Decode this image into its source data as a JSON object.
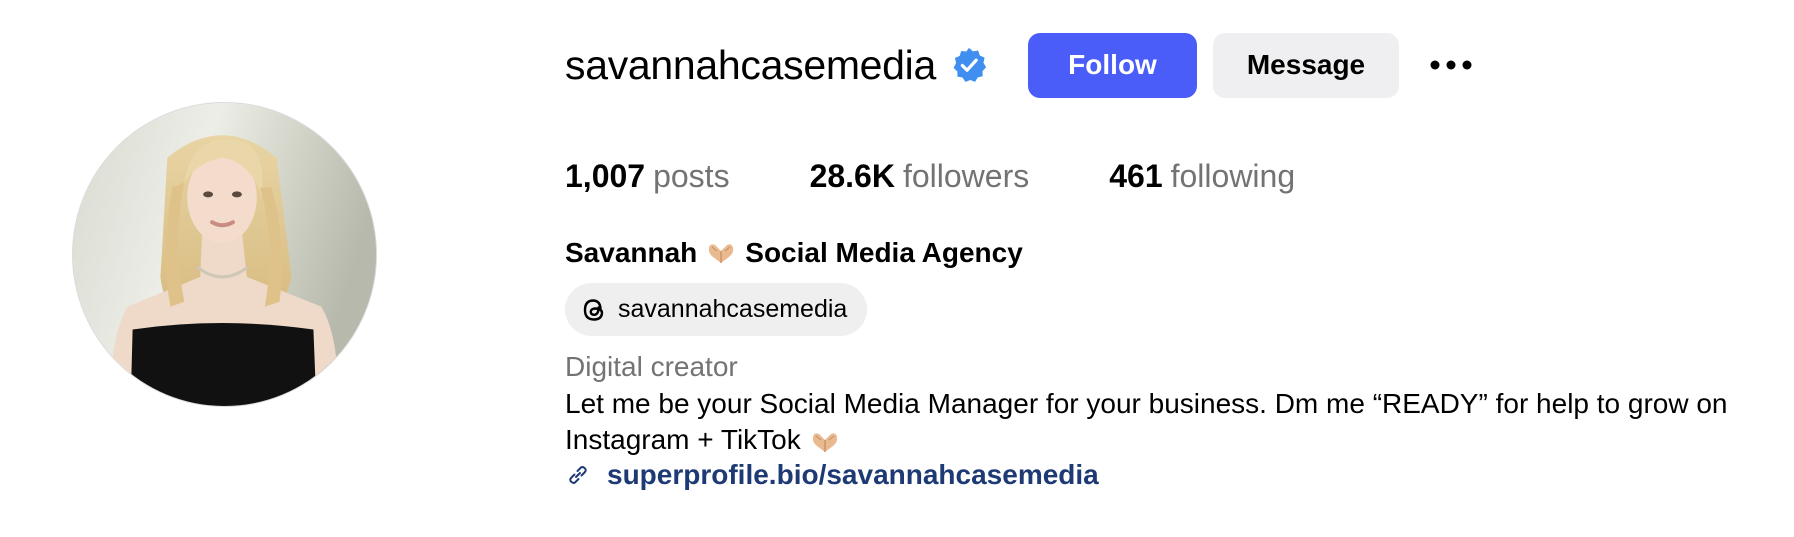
{
  "profile": {
    "username": "savannahcasemedia",
    "verified_icon": "verified-badge-icon",
    "follow_label": "Follow",
    "message_label": "Message",
    "more_icon": "more-options-icon"
  },
  "stats": {
    "posts_count": "1,007",
    "posts_label": "posts",
    "followers_count": "28.6K",
    "followers_label": "followers",
    "following_count": "461",
    "following_label": "following"
  },
  "bio": {
    "name_first": "Savannah",
    "name_rest": "Social Media Agency",
    "threads_handle": "savannahcasemedia",
    "threads_icon": "threads-icon",
    "category": "Digital creator",
    "line1": "Let me be your Social Media Manager for your business. Dm me “READY” for help to grow on",
    "line2": "Instagram + TikTok",
    "emoji_icon": "heart-hands-icon",
    "link_icon": "link-icon",
    "link": "superprofile.bio/savannahcasemedia"
  },
  "colors": {
    "follow_button": "#4a5df9",
    "message_button": "#efeff1",
    "verified": "#3f8ef0",
    "link": "#1e3a74",
    "secondary_text": "#737373"
  }
}
